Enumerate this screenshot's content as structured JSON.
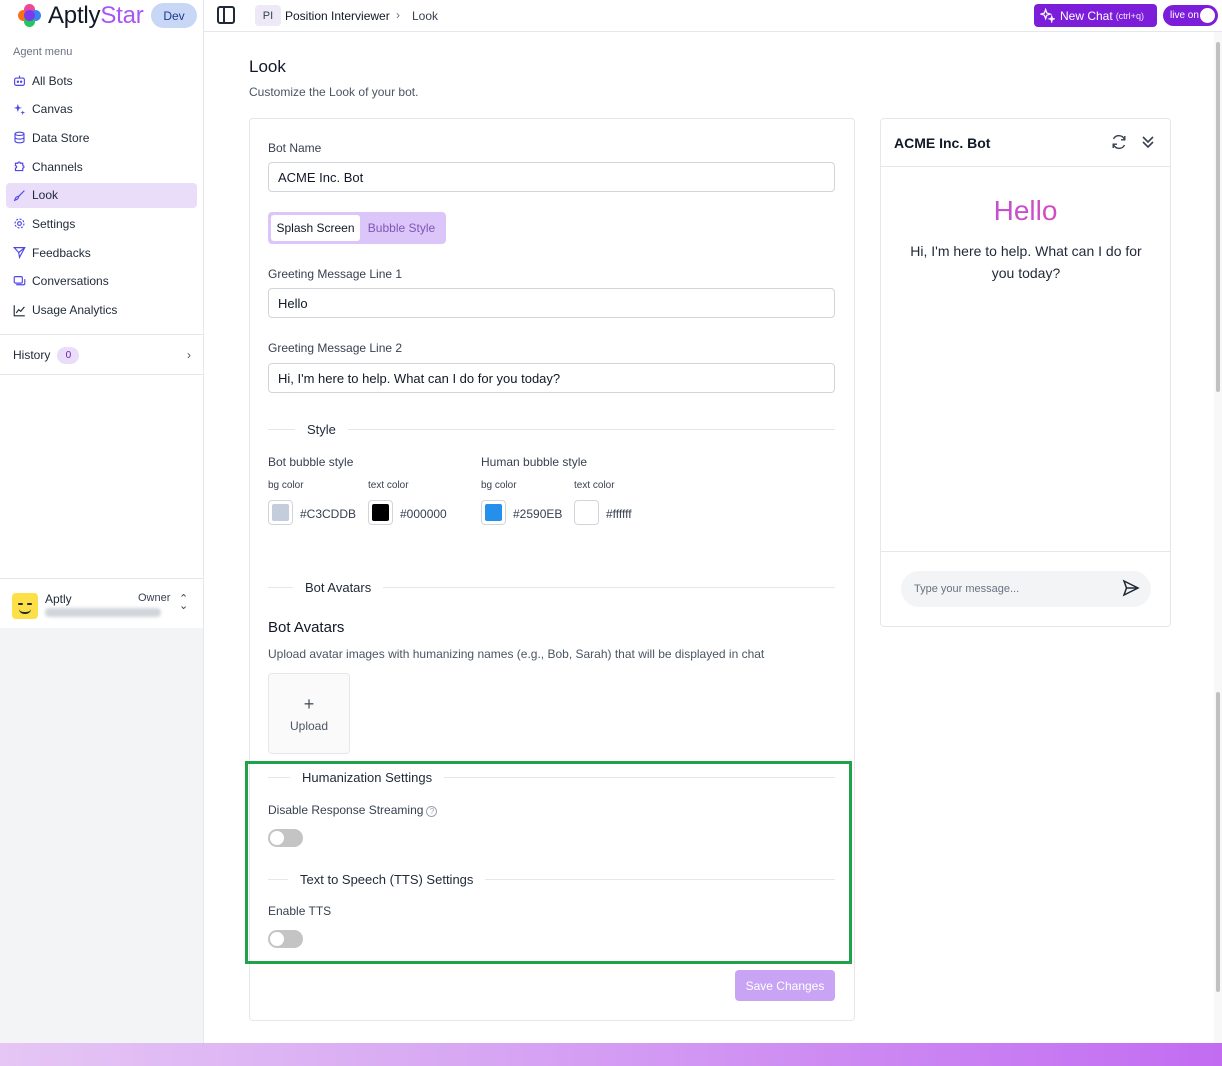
{
  "app": {
    "logo_text_a": "Aptly",
    "logo_text_b": "Star",
    "env_badge": "Dev"
  },
  "sidebar": {
    "heading": "Agent menu",
    "items": [
      {
        "label": "All Bots",
        "icon": "bot-icon"
      },
      {
        "label": "Canvas",
        "icon": "sparkles-icon"
      },
      {
        "label": "Data Store",
        "icon": "database-icon"
      },
      {
        "label": "Channels",
        "icon": "puzzle-icon"
      },
      {
        "label": "Look",
        "icon": "brush-icon",
        "active": true
      },
      {
        "label": "Settings",
        "icon": "gear-icon"
      },
      {
        "label": "Feedbacks",
        "icon": "send-icon"
      },
      {
        "label": "Conversations",
        "icon": "chat-icon"
      },
      {
        "label": "Usage Analytics",
        "icon": "chart-icon"
      }
    ],
    "history_label": "History",
    "history_count": "0",
    "user_name": "Aptly",
    "user_role": "Owner"
  },
  "topbar": {
    "crumb_initials": "PI",
    "crumb_bot": "Position Interviewer",
    "crumb_page": "Look",
    "new_chat_label": "New Chat",
    "new_chat_shortcut": "(ctrl+q)",
    "live_label": "live on"
  },
  "page": {
    "title": "Look",
    "subtitle": "Customize the Look of your bot."
  },
  "form": {
    "bot_name_label": "Bot Name",
    "bot_name_value": "ACME Inc. Bot",
    "tabs": [
      "Splash Screen",
      "Bubble Style"
    ],
    "greeting1_label": "Greeting Message Line 1",
    "greeting1_value": "Hello",
    "greeting2_label": "Greeting Message Line 2",
    "greeting2_value": "Hi, I'm here to help. What can I do for you today?",
    "style_heading": "Style",
    "bot_bubble_label": "Bot bubble style",
    "human_bubble_label": "Human bubble style",
    "bg_color_label": "bg color",
    "text_color_label": "text color",
    "colors": {
      "bot_bg": "#C3CDDB",
      "bot_text": "#000000",
      "human_bg": "#2590EB",
      "human_text": "#ffffff"
    },
    "avatars_heading": "Bot Avatars",
    "avatars_title": "Bot Avatars",
    "avatars_desc": "Upload avatar images with humanizing names (e.g., Bob, Sarah) that will be displayed in chat",
    "upload_label": "Upload",
    "humanization_heading": "Humanization Settings",
    "disable_streaming_label": "Disable Response Streaming",
    "disable_streaming_on": false,
    "tts_heading": "Text to Speech (TTS) Settings",
    "enable_tts_label": "Enable TTS",
    "enable_tts_on": false,
    "save_label": "Save Changes"
  },
  "preview": {
    "title": "ACME Inc. Bot",
    "hello": "Hello",
    "message": "Hi, I'm here to help. What can I do for you today?",
    "input_placeholder": "Type your message..."
  }
}
